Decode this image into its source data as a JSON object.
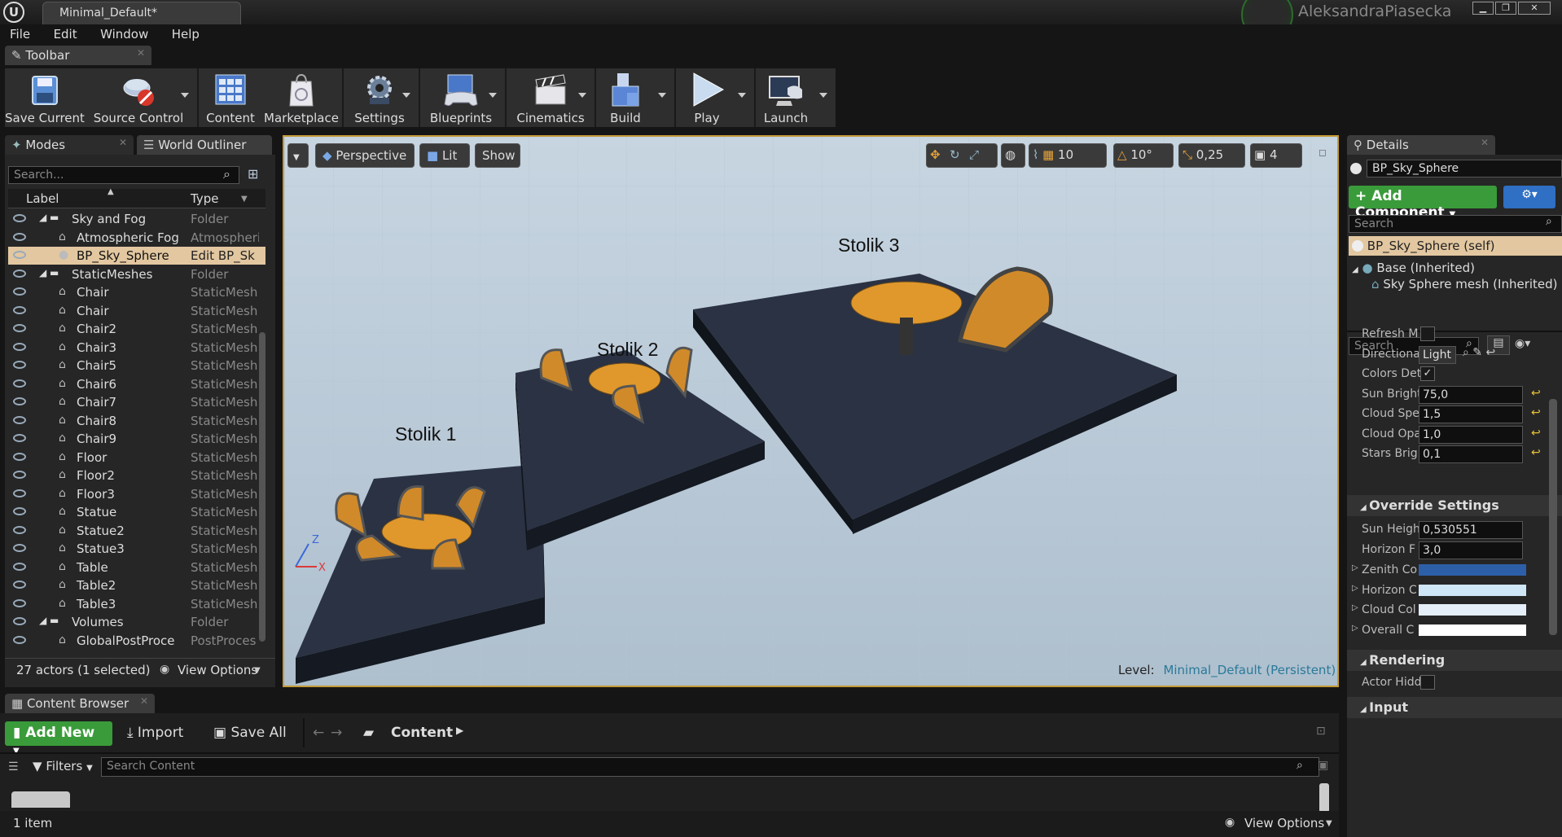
{
  "window": {
    "doc_tab": "Minimal_Default*",
    "user": "AleksandraPiasecka",
    "min": "▁",
    "max": "❐",
    "close": "✕"
  },
  "menu": [
    "File",
    "Edit",
    "Window",
    "Help"
  ],
  "toolbar": {
    "tab": "Toolbar",
    "buttons": [
      "Save Current",
      "Source Control",
      "Content",
      "Marketplace",
      "Settings",
      "Blueprints",
      "Cinematics",
      "Build",
      "Play",
      "Launch"
    ]
  },
  "left_tabs": {
    "modes": "Modes",
    "outliner": "World Outliner"
  },
  "outliner": {
    "search_placeholder": "Search...",
    "col_label": "Label",
    "col_type": "Type",
    "rows": [
      {
        "label": "Sky and Fog",
        "type": "Folder"
      },
      {
        "label": "Atmospheric Fog",
        "type": "Atmospheri"
      },
      {
        "label": "BP_Sky_Sphere",
        "type": "Edit BP_Sk"
      },
      {
        "label": "StaticMeshes",
        "type": "Folder"
      },
      {
        "label": "Chair",
        "type": "StaticMesh"
      },
      {
        "label": "Chair",
        "type": "StaticMesh"
      },
      {
        "label": "Chair2",
        "type": "StaticMesh"
      },
      {
        "label": "Chair3",
        "type": "StaticMesh"
      },
      {
        "label": "Chair5",
        "type": "StaticMesh"
      },
      {
        "label": "Chair6",
        "type": "StaticMesh"
      },
      {
        "label": "Chair7",
        "type": "StaticMesh"
      },
      {
        "label": "Chair8",
        "type": "StaticMesh"
      },
      {
        "label": "Chair9",
        "type": "StaticMesh"
      },
      {
        "label": "Floor",
        "type": "StaticMesh"
      },
      {
        "label": "Floor2",
        "type": "StaticMesh"
      },
      {
        "label": "Floor3",
        "type": "StaticMesh"
      },
      {
        "label": "Statue",
        "type": "StaticMesh"
      },
      {
        "label": "Statue2",
        "type": "StaticMesh"
      },
      {
        "label": "Statue3",
        "type": "StaticMesh"
      },
      {
        "label": "Table",
        "type": "StaticMesh"
      },
      {
        "label": "Table2",
        "type": "StaticMesh"
      },
      {
        "label": "Table3",
        "type": "StaticMesh"
      },
      {
        "label": "Volumes",
        "type": "Folder"
      },
      {
        "label": "GlobalPostProce",
        "type": "PostProces"
      }
    ],
    "status": "27 actors (1 selected)",
    "view_options": "View Options"
  },
  "viewport": {
    "perspective": "Perspective",
    "lit": "Lit",
    "show": "Show",
    "grid_snap": "10",
    "rot_snap": "10°",
    "scale_snap": "0,25",
    "cam_speed": "4",
    "labels": [
      "Stolik 1",
      "Stolik 2",
      "Stolik 3"
    ],
    "level_label": "Level:",
    "level_name": "Minimal_Default (Persistent)",
    "axis_z": "Z",
    "axis_x": "X"
  },
  "details": {
    "tab": "Details",
    "actor_name": "BP_Sky_Sphere",
    "add_component": "+ Add Component",
    "search_placeholder": "Search",
    "self_item": "BP_Sky_Sphere (self)",
    "base": "Base (Inherited)",
    "mesh": "Sky Sphere mesh (Inherited)",
    "search2_placeholder": "Search",
    "props": [
      {
        "name": "Refresh M",
        "kind": "check",
        "value": ""
      },
      {
        "name": "Directiona",
        "kind": "select",
        "value": "Light"
      },
      {
        "name": "Colors Det",
        "kind": "checked",
        "value": ""
      },
      {
        "name": "Sun Bright",
        "kind": "num",
        "value": "75,0"
      },
      {
        "name": "Cloud Spe",
        "kind": "num",
        "value": "1,5"
      },
      {
        "name": "Cloud Opa",
        "kind": "num",
        "value": "1,0"
      },
      {
        "name": "Stars Brig",
        "kind": "num",
        "value": "0,1"
      }
    ],
    "override_title": "Override Settings",
    "override_props": [
      {
        "name": "Sun Heigh",
        "value": "0,530551"
      },
      {
        "name": "Horizon F",
        "value": "3,0"
      }
    ],
    "color_props": [
      {
        "name": "Zenith Co",
        "color": "#2d5fa8"
      },
      {
        "name": "Horizon C",
        "color": "#cfe6f7"
      },
      {
        "name": "Cloud Col",
        "color": "#e4effa"
      },
      {
        "name": "Overall C",
        "color": "#ffffff"
      }
    ],
    "rendering_title": "Rendering",
    "actor_hidden": "Actor Hidd",
    "input_title": "Input"
  },
  "content_browser": {
    "tab": "Content Browser",
    "add_new": "Add New",
    "import": "Import",
    "save_all": "Save All",
    "path": "Content",
    "filters": "Filters",
    "search_placeholder": "Search Content",
    "items": "1 item",
    "view_options": "View Options"
  }
}
